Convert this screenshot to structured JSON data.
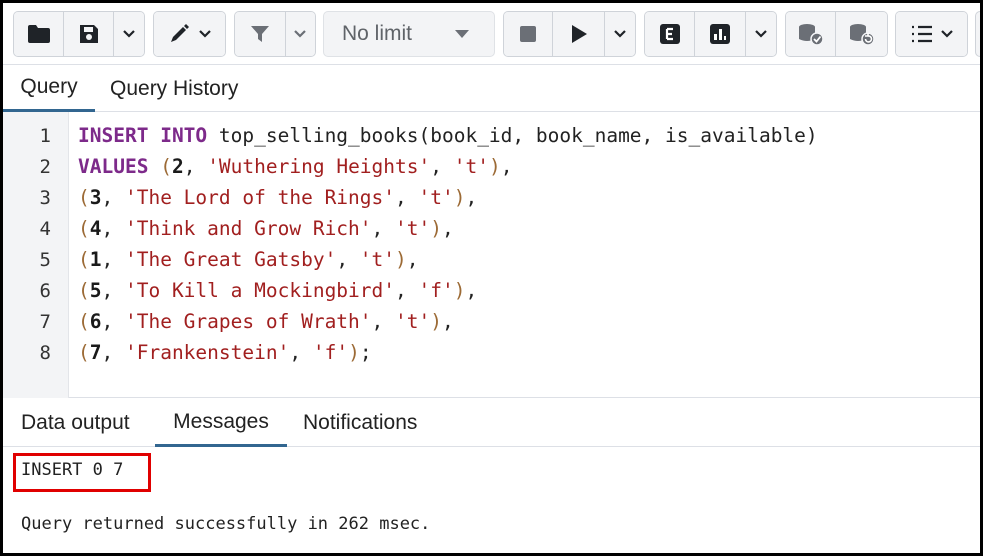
{
  "toolbar": {
    "limit_value": "No limit",
    "icons": [
      "folder-icon",
      "save-icon",
      "pen-icon",
      "filter-icon",
      "stop-icon",
      "play-icon",
      "explain-icon",
      "explain-analyze-icon",
      "commit-icon",
      "rollback-icon",
      "macros-icon"
    ]
  },
  "query_tabs": [
    {
      "label": "Query",
      "active": true
    },
    {
      "label": "Query History",
      "active": false
    }
  ],
  "editor": {
    "line_numbers": [
      "1",
      "2",
      "3",
      "4",
      "5",
      "6",
      "7",
      "8"
    ],
    "lines": [
      [
        {
          "t": "INSERT",
          "c": "kw"
        },
        {
          "t": " ",
          "c": "punct"
        },
        {
          "t": "INTO",
          "c": "kw"
        },
        {
          "t": " top_selling_books(book_id, book_name, is_available)",
          "c": "punct"
        }
      ],
      [
        {
          "t": "VALUES",
          "c": "kw"
        },
        {
          "t": " ",
          "c": "punct"
        },
        {
          "t": "(",
          "c": "paren"
        },
        {
          "t": "2",
          "c": "num"
        },
        {
          "t": ", ",
          "c": "punct"
        },
        {
          "t": "'Wuthering Heights'",
          "c": "str"
        },
        {
          "t": ", ",
          "c": "punct"
        },
        {
          "t": "'t'",
          "c": "str"
        },
        {
          "t": ")",
          "c": "paren"
        },
        {
          "t": ",",
          "c": "punct"
        }
      ],
      [
        {
          "t": "(",
          "c": "paren"
        },
        {
          "t": "3",
          "c": "num"
        },
        {
          "t": ", ",
          "c": "punct"
        },
        {
          "t": "'The Lord of the Rings'",
          "c": "str"
        },
        {
          "t": ", ",
          "c": "punct"
        },
        {
          "t": "'t'",
          "c": "str"
        },
        {
          "t": ")",
          "c": "paren"
        },
        {
          "t": ",",
          "c": "punct"
        }
      ],
      [
        {
          "t": "(",
          "c": "paren"
        },
        {
          "t": "4",
          "c": "num"
        },
        {
          "t": ", ",
          "c": "punct"
        },
        {
          "t": "'Think and Grow Rich'",
          "c": "str"
        },
        {
          "t": ", ",
          "c": "punct"
        },
        {
          "t": "'t'",
          "c": "str"
        },
        {
          "t": ")",
          "c": "paren"
        },
        {
          "t": ",",
          "c": "punct"
        }
      ],
      [
        {
          "t": "(",
          "c": "paren"
        },
        {
          "t": "1",
          "c": "num"
        },
        {
          "t": ", ",
          "c": "punct"
        },
        {
          "t": "'The Great Gatsby'",
          "c": "str"
        },
        {
          "t": ", ",
          "c": "punct"
        },
        {
          "t": "'t'",
          "c": "str"
        },
        {
          "t": ")",
          "c": "paren"
        },
        {
          "t": ",",
          "c": "punct"
        }
      ],
      [
        {
          "t": "(",
          "c": "paren"
        },
        {
          "t": "5",
          "c": "num"
        },
        {
          "t": ", ",
          "c": "punct"
        },
        {
          "t": "'To Kill a Mockingbird'",
          "c": "str"
        },
        {
          "t": ", ",
          "c": "punct"
        },
        {
          "t": "'f'",
          "c": "str"
        },
        {
          "t": ")",
          "c": "paren"
        },
        {
          "t": ",",
          "c": "punct"
        }
      ],
      [
        {
          "t": "(",
          "c": "paren"
        },
        {
          "t": "6",
          "c": "num"
        },
        {
          "t": ", ",
          "c": "punct"
        },
        {
          "t": "'The Grapes of Wrath'",
          "c": "str"
        },
        {
          "t": ", ",
          "c": "punct"
        },
        {
          "t": "'t'",
          "c": "str"
        },
        {
          "t": ")",
          "c": "paren"
        },
        {
          "t": ",",
          "c": "punct"
        }
      ],
      [
        {
          "t": "(",
          "c": "paren"
        },
        {
          "t": "7",
          "c": "num"
        },
        {
          "t": ", ",
          "c": "punct"
        },
        {
          "t": "'Frankenstein'",
          "c": "str"
        },
        {
          "t": ", ",
          "c": "punct"
        },
        {
          "t": "'f'",
          "c": "str"
        },
        {
          "t": ")",
          "c": "paren"
        },
        {
          "t": ";",
          "c": "punct"
        }
      ]
    ]
  },
  "result_tabs": [
    {
      "label": "Data output",
      "active": false
    },
    {
      "label": "Messages",
      "active": true
    },
    {
      "label": "Notifications",
      "active": false
    }
  ],
  "messages": {
    "result": "INSERT 0 7",
    "status": "Query returned successfully in 262 msec."
  },
  "colors": {
    "keyword": "#7d2a8a",
    "string": "#a11f1f",
    "active_tab_underline": "#326690",
    "highlight_box": "#e00000"
  }
}
